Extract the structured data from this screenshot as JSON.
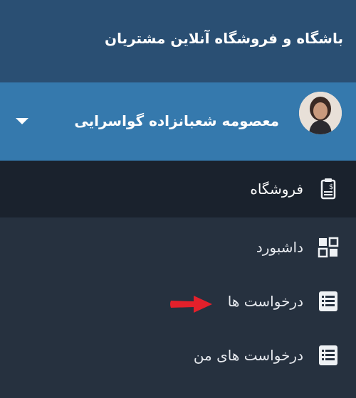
{
  "header": {
    "title": "باشگاه و فروشگاه آنلاین مشتریان"
  },
  "user": {
    "name": "معصومه شعبانزاده گواسرایی",
    "avatar_icon": "user-avatar"
  },
  "menu": {
    "items": [
      {
        "label": "فروشگاه",
        "icon": "receipt-icon",
        "active": true
      },
      {
        "label": "داشبورد",
        "icon": "dashboard-grid-icon",
        "active": false
      },
      {
        "label": "درخواست ها",
        "icon": "list-icon",
        "active": false
      },
      {
        "label": "درخواست های من",
        "icon": "list-icon",
        "active": false
      }
    ]
  },
  "colors": {
    "header_bg": "#2a4f73",
    "user_bar_bg": "#3579ad",
    "sidebar_bg": "#26313f",
    "active_item_bg": "#1a222d",
    "annotation_arrow": "#e3202b"
  }
}
